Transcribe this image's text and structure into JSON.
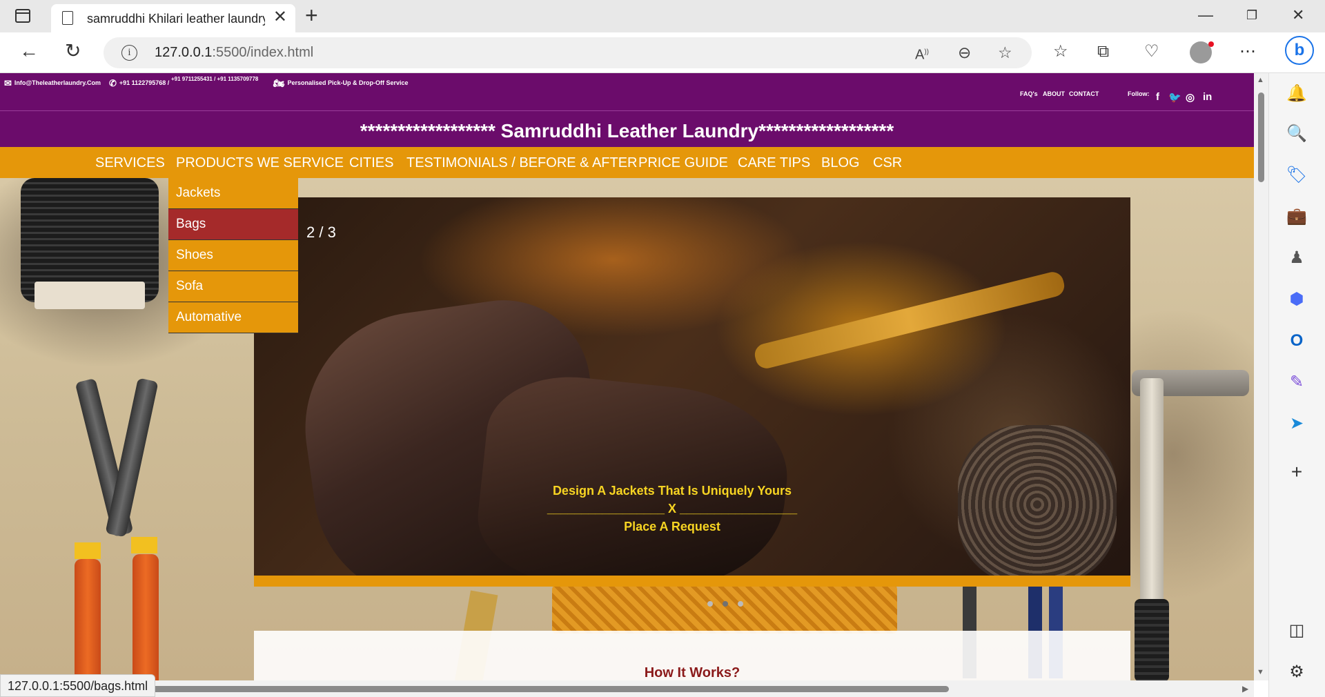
{
  "browser": {
    "tab_title": "samruddhi Khilari leather laundry",
    "url_host": "127.0.0.1",
    "url_rest": ":5500/index.html",
    "status_url": "127.0.0.1:5500/bags.html"
  },
  "topbar": {
    "email": "Info@Theleatherlaundry.Com",
    "phone1": "+91 1122795768 /",
    "phone2": "+91 9711255431 / +91 1135709778",
    "pickup": "Personalised Pick-Up & Drop-Off Service",
    "links": [
      "FAQ's",
      "ABOUT",
      "CONTACT"
    ],
    "follow_label": "Follow:"
  },
  "site_title": "****************** Samruddhi Leather Laundry******************",
  "menu": [
    "SERVICES",
    "PRODUCTS WE SERVICE",
    "CITIES",
    "TESTIMONIALS / BEFORE & AFTER",
    "PRICE GUIDE",
    "CARE TIPS",
    "BLOG",
    "CSR"
  ],
  "dropdown": [
    "Jackets",
    "Bags",
    "Shoes",
    "Sofa",
    "Automative"
  ],
  "slider": {
    "counter": "2 / 3",
    "caption_line1": "Design A Jackets That Is Uniquely Yours",
    "caption_line2": "_________________ X _________________",
    "caption_line3": "Place A Request",
    "slides_total": 3,
    "active_slide": 2
  },
  "how_it_works_title": "How It Works?",
  "colors": {
    "topbar_purple": "#6b0c6b",
    "menu_orange": "#e5970a",
    "dropdown_hover": "#a52a2a",
    "caption_yellow": "#f7d422",
    "how_title_red": "#8b1a1a"
  },
  "icons": {
    "email": "envelope-icon",
    "phone": "phone-icon",
    "pickup": "motorbike-icon",
    "social": [
      "facebook-icon",
      "twitter-icon",
      "instagram-icon",
      "linkedin-icon"
    ]
  }
}
